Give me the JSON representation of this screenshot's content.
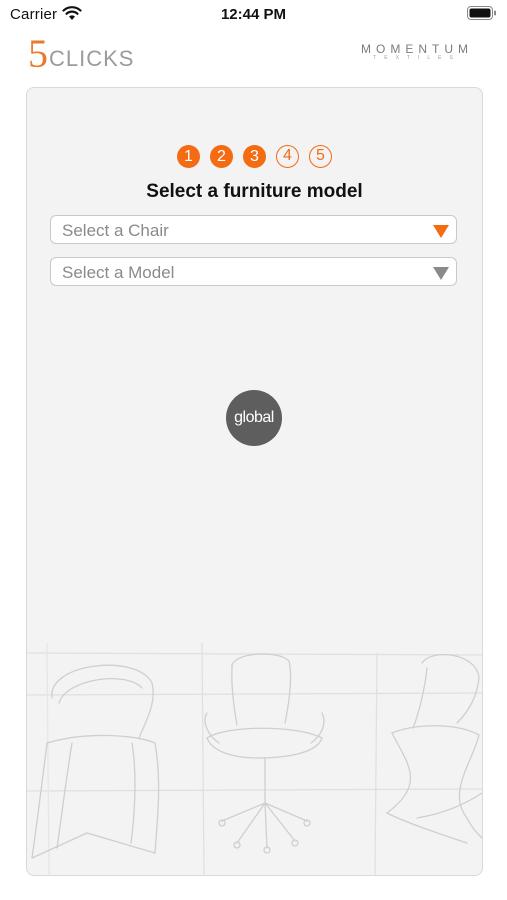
{
  "status_bar": {
    "carrier": "Carrier",
    "time": "12:44 PM",
    "wifi_icon": "wifi-icon",
    "battery_icon": "battery-icon"
  },
  "header": {
    "logo_left": {
      "digit": "5",
      "word": "CLICKS"
    },
    "logo_right": {
      "word": "MOMENTUM",
      "sub": "TEXTILES"
    }
  },
  "wizard": {
    "steps": [
      {
        "label": "1",
        "state": "done"
      },
      {
        "label": "2",
        "state": "done"
      },
      {
        "label": "3",
        "state": "done"
      },
      {
        "label": "4",
        "state": "todo"
      },
      {
        "label": "5",
        "state": "todo"
      }
    ],
    "title": "Select a furniture model",
    "chair_select": {
      "placeholder": "Select a Chair",
      "arrow_color": "#f36b12"
    },
    "model_select": {
      "placeholder": "Select a Model",
      "arrow_color": "#8a8a8a"
    },
    "brand_badge": "global"
  },
  "colors": {
    "accent": "#f36b12",
    "logo_orange": "#ea7a2b",
    "card_bg": "#f3f3f3",
    "badge_bg": "#5e5e5e"
  },
  "decor": {
    "background_image": "chair-sketches-illustration"
  }
}
